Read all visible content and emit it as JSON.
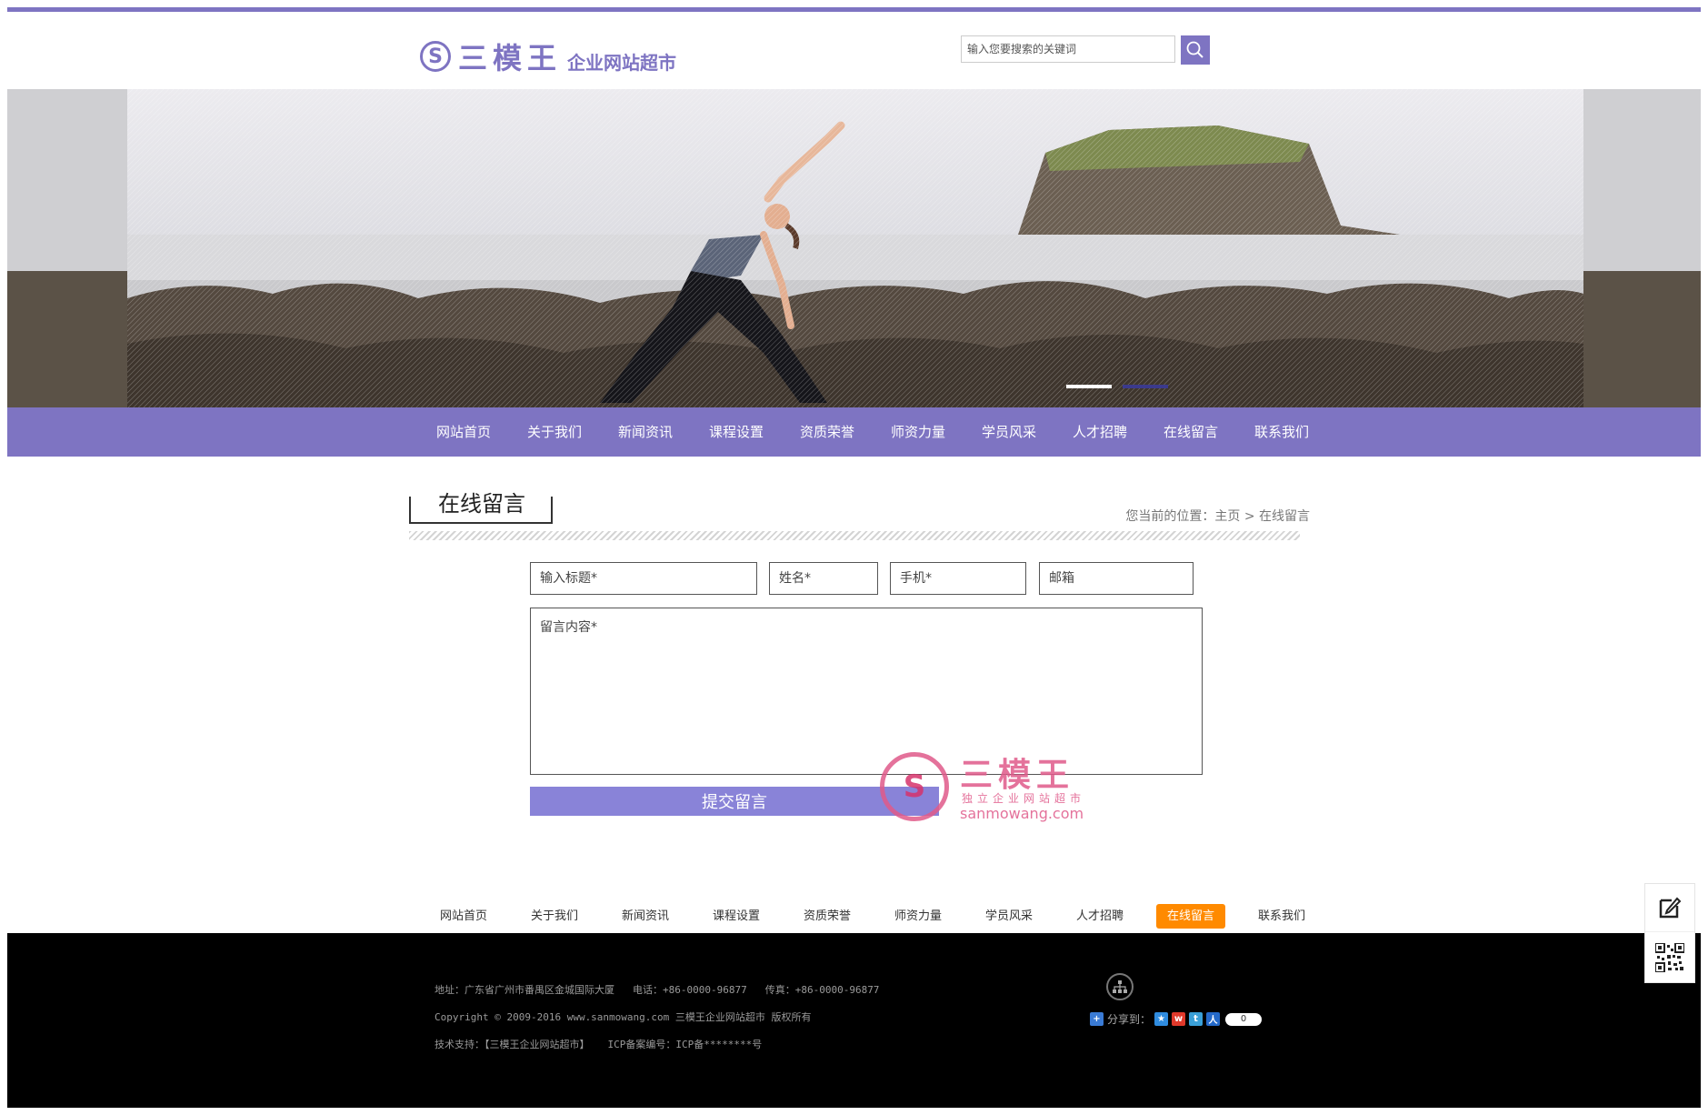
{
  "header": {
    "logo_mark": "S",
    "logo_brand": "三模王",
    "logo_sub": "企业网站超市",
    "search_placeholder": "输入您要搜索的关键词"
  },
  "colors": {
    "accent": "#7e74c2",
    "submit": "#8983d8",
    "active_tab": "#ff8a00",
    "footer_bg": "#000000"
  },
  "nav": [
    "网站首页",
    "关于我们",
    "新闻资讯",
    "课程设置",
    "资质荣誉",
    "师资力量",
    "学员风采",
    "人才招聘",
    "在线留言",
    "联系我们"
  ],
  "banner": {
    "slides": 2,
    "active_slide": 1
  },
  "page": {
    "title": "在线留言",
    "breadcrumb_prefix": "您当前的位置：",
    "breadcrumb_home": "主页",
    "breadcrumb_sep": ">",
    "breadcrumb_current": "在线留言"
  },
  "form": {
    "title_placeholder": "输入标题*",
    "name_placeholder": "姓名*",
    "phone_placeholder": "手机*",
    "email_placeholder": "邮箱",
    "content_placeholder": "留言内容*",
    "submit_label": "提交留言"
  },
  "watermark": {
    "brand": "三模王",
    "tagline": "独立企业网站超市",
    "url": "sanmowang.com"
  },
  "bottom_nav": {
    "items": [
      "网站首页",
      "关于我们",
      "新闻资讯",
      "课程设置",
      "资质荣誉",
      "师资力量",
      "学员风采",
      "人才招聘",
      "在线留言",
      "联系我们"
    ],
    "active_index": 8
  },
  "footer": {
    "address": "地址：广东省广州市番禺区金城国际大厦",
    "phone": "电话：+86-0000-96877",
    "fax": "传真：+86-0000-96877",
    "copyright": "Copyright © 2009-2016 www.sanmowang.com 三模王企业网站超市 版权所有",
    "support": "技术支持：【三模王企业网站超市】",
    "icp": "ICP备案编号：ICP备********号",
    "share_label": "分享到：",
    "share_count": "0"
  },
  "icons": [
    "search-icon",
    "sitemap-icon",
    "share-plus-icon",
    "edit-icon",
    "qr-code-icon"
  ]
}
